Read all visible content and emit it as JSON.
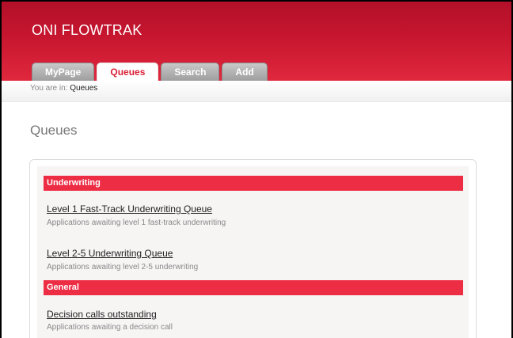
{
  "app": {
    "title": "ONI FLOWTRAK"
  },
  "tabs": [
    {
      "label": "MyPage",
      "active": false
    },
    {
      "label": "Queues",
      "active": true
    },
    {
      "label": "Search",
      "active": false
    },
    {
      "label": "Add",
      "active": false
    }
  ],
  "breadcrumb": {
    "prefix": "You are in:",
    "current": "Queues"
  },
  "page": {
    "title": "Queues"
  },
  "sections": [
    {
      "header": "Underwriting",
      "items": [
        {
          "label": "Level 1 Fast-Track Underwriting Queue",
          "description": "Applications awaiting level 1 fast-track underwriting"
        },
        {
          "label": "Level 2-5 Underwriting Queue",
          "description": "Applications awaiting level 2-5 underwriting"
        }
      ]
    },
    {
      "header": "General",
      "items": [
        {
          "label": "Decision calls outstanding",
          "description": "Applications awaiting a decision call"
        }
      ]
    }
  ],
  "colors": {
    "brand": "#c7162f",
    "section_header": "#ec2d44",
    "tab_inactive": "#a8a8a8"
  }
}
